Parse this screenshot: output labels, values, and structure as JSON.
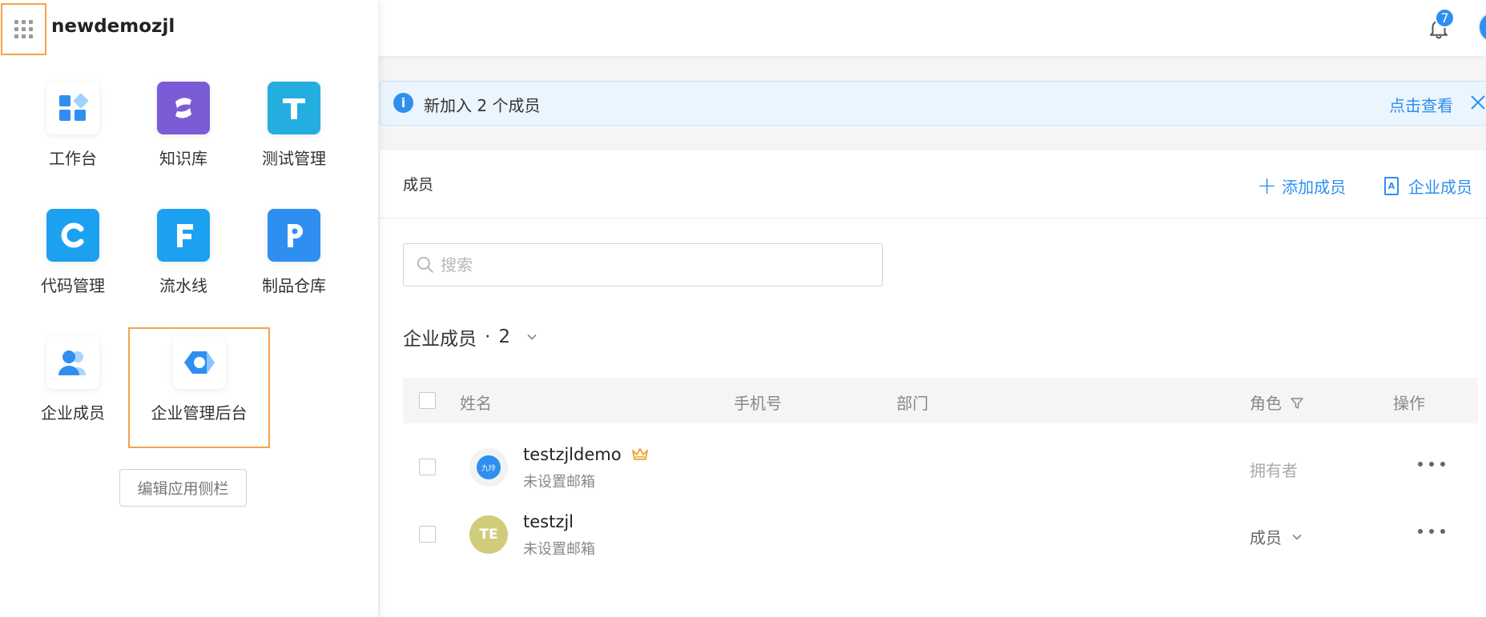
{
  "launcher": {
    "org_name": "newdemozjl",
    "apps": [
      {
        "label": "工作台",
        "icon": "workbench-icon"
      },
      {
        "label": "知识库",
        "icon": "knowledge-base-icon"
      },
      {
        "label": "测试管理",
        "icon": "test-management-icon"
      },
      {
        "label": "代码管理",
        "icon": "code-management-icon"
      },
      {
        "label": "流水线",
        "icon": "pipeline-icon"
      },
      {
        "label": "制品仓库",
        "icon": "artifact-repository-icon"
      },
      {
        "label": "企业成员",
        "icon": "enterprise-members-icon"
      },
      {
        "label": "企业管理后台",
        "icon": "admin-console-icon"
      }
    ],
    "edit_sidebar_label": "编辑应用侧栏"
  },
  "topbar": {
    "notification_count": "7"
  },
  "notice": {
    "info_glyph": "i",
    "text": "新加入 2 个成员",
    "link": "点击查看"
  },
  "members": {
    "title": "成员",
    "add_member_label": "添加成员",
    "corp_member_label": "企业成员",
    "search_placeholder": "搜索",
    "group_label": "企业成员",
    "group_separator": "·",
    "group_count": "2",
    "columns": {
      "name": "姓名",
      "phone": "手机号",
      "department": "部门",
      "role": "角色",
      "actions": "操作"
    },
    "rows": [
      {
        "name": "testzjldemo",
        "email": "未设置邮箱",
        "role": "拥有者",
        "avatar_text": "九玲",
        "avatar_color": "#2e8ff0"
      },
      {
        "name": "testzjl",
        "email": "未设置邮箱",
        "role": "成员",
        "avatar_text": "TE",
        "avatar_color": "#cfcd7c"
      }
    ]
  },
  "colors": {
    "accent": "#2e8ff0",
    "highlight_border": "#f3a34a",
    "crown": "#f0a020"
  }
}
